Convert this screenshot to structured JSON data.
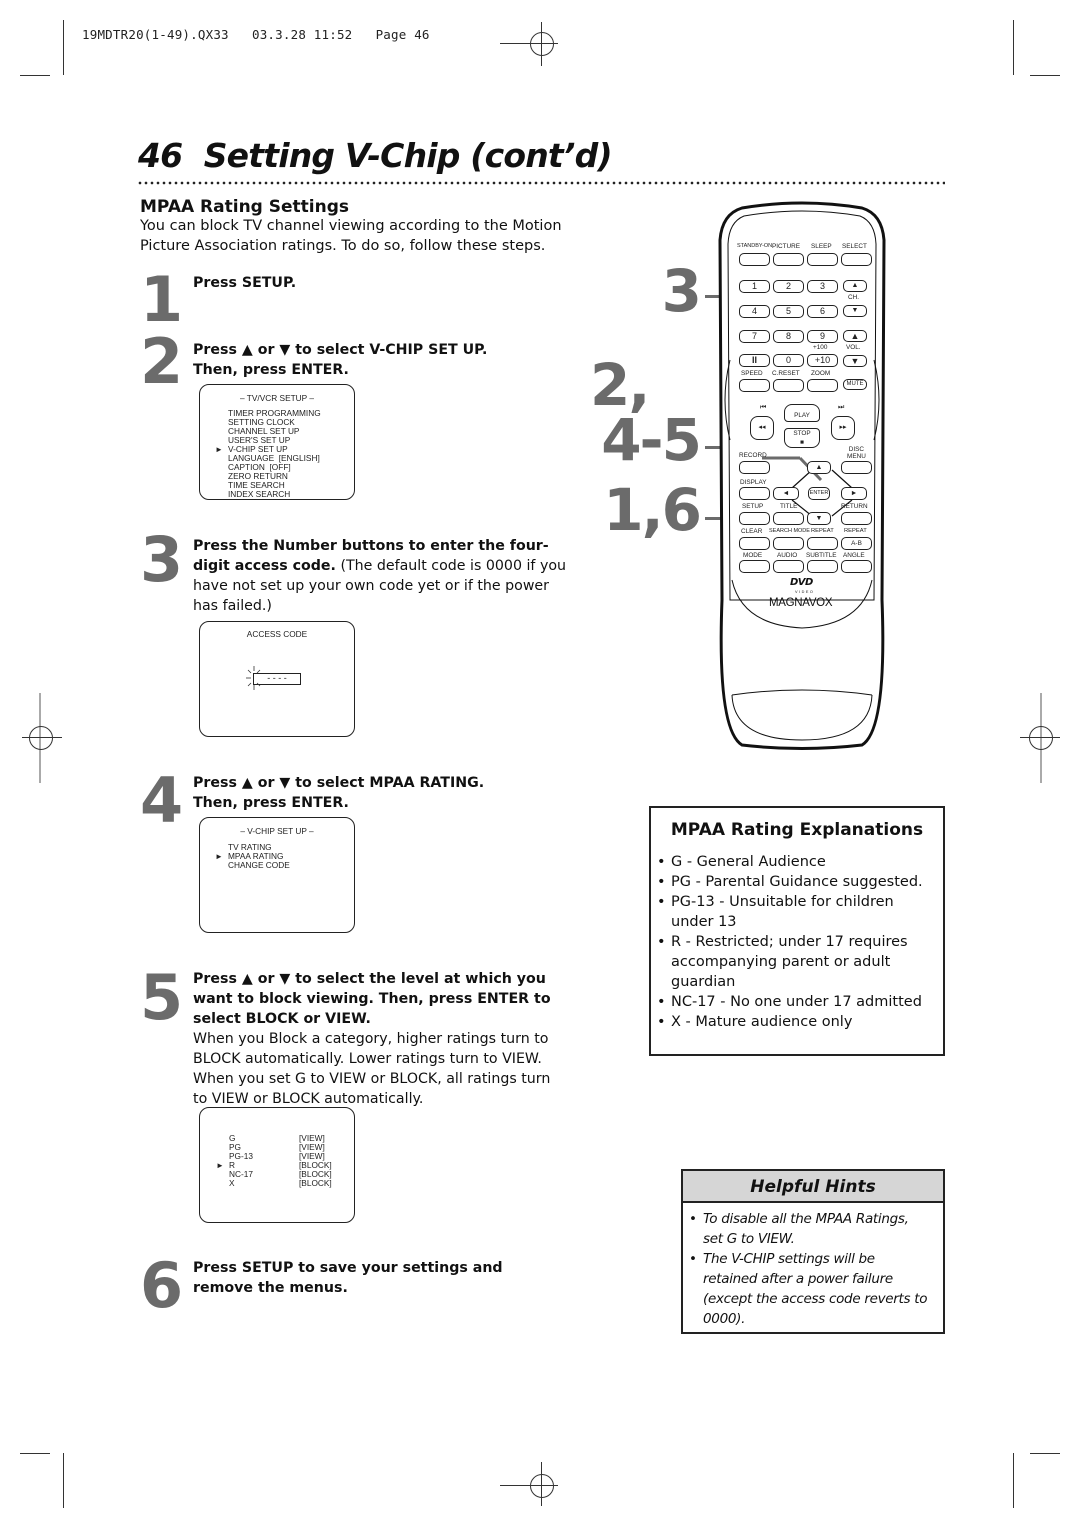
{
  "slug": {
    "text": "19MDTR20(1-49).QX33   03.3.28 11:52   Page 46"
  },
  "page": {
    "number": "46",
    "title": "Setting V-Chip (cont’d)"
  },
  "section": {
    "heading": "MPAA Rating Settings",
    "intro": [
      "You can block TV channel viewing according to the Motion",
      "Picture Association ratings. To do so, follow these steps."
    ]
  },
  "steps": [
    {
      "num": "1",
      "lines": [
        {
          "bold": "Press SETUP.",
          "normal": ""
        }
      ]
    },
    {
      "num": "2",
      "lines": [
        {
          "bold": "Press ▲ or ▼ to select V-CHIP SET UP.",
          "normal": ""
        },
        {
          "bold": "Then, press ENTER.",
          "normal": ""
        }
      ]
    },
    {
      "num": "3",
      "lines": [
        {
          "bold": "Press the Number buttons to enter the four-",
          "normal": ""
        },
        {
          "bold": "digit access code.",
          "normal": " (The default code is 0000 if you"
        },
        {
          "bold": "",
          "normal": "have not set up your own code yet or if the power"
        },
        {
          "bold": "",
          "normal": "has failed.)"
        }
      ]
    },
    {
      "num": "4",
      "lines": [
        {
          "bold": "Press ▲ or ▼ to select MPAA RATING.",
          "normal": ""
        },
        {
          "bold": "Then, press ENTER.",
          "normal": ""
        }
      ]
    },
    {
      "num": "5",
      "lines": [
        {
          "bold": "Press ▲ or ▼ to select the level at which you",
          "normal": ""
        },
        {
          "bold": "want to block viewing. Then, press ENTER to",
          "normal": ""
        },
        {
          "bold": "select BLOCK or VIEW.",
          "normal": ""
        },
        {
          "bold": "",
          "normal": "When you Block a category, higher ratings turn to"
        },
        {
          "bold": "",
          "normal": "BLOCK automatically. Lower ratings turn to VIEW."
        },
        {
          "bold": "",
          "normal": "When you set G to VIEW or BLOCK, all ratings turn"
        },
        {
          "bold": "",
          "normal": "to VIEW or BLOCK automatically."
        }
      ]
    },
    {
      "num": "6",
      "lines": [
        {
          "bold": "Press SETUP to save your settings and",
          "normal": ""
        },
        {
          "bold": "remove the menus.",
          "normal": ""
        }
      ]
    }
  ],
  "screens": {
    "tvvcr_setup": {
      "header": "– TV/VCR SETUP –",
      "items": [
        "TIMER PROGRAMMING",
        "SETTING CLOCK",
        "CHANNEL SET UP",
        "USER'S SET UP",
        "V-CHIP SET UP",
        "LANGUAGE  [ENGLISH]",
        "CAPTION  [OFF]",
        "ZERO RETURN",
        "TIME SEARCH",
        "INDEX SEARCH"
      ],
      "selected_index": 4
    },
    "access_code": {
      "header": "ACCESS CODE",
      "field": "- - - -"
    },
    "vchip_setup": {
      "header": "– V-CHIP SET UP –",
      "items": [
        "TV RATING",
        "MPAA RATING",
        "CHANGE CODE"
      ],
      "selected_index": 1
    },
    "mpaa_levels": {
      "rows": [
        {
          "rating": "G",
          "status": "[VIEW]"
        },
        {
          "rating": "PG",
          "status": "[VIEW]"
        },
        {
          "rating": "PG-13",
          "status": "[VIEW]"
        },
        {
          "rating": "R",
          "status": "[BLOCK]"
        },
        {
          "rating": "NC-17",
          "status": "[BLOCK]"
        },
        {
          "rating": "X",
          "status": "[BLOCK]"
        }
      ],
      "selected_index": 3
    },
    "arrow_glyph": "►"
  },
  "remote": {
    "brand": "MAGNAVOX",
    "disc_logo": "DVD",
    "disc_logo_sub": "VIDEO",
    "top_labels": [
      "STANDBY-ON",
      "PICTURE",
      "SLEEP",
      "SELECT"
    ],
    "digits": [
      "1",
      "2",
      "3",
      "4",
      "5",
      "6",
      "7",
      "8",
      "9",
      "II",
      "0",
      "+10"
    ],
    "plus100": "+100",
    "ch_label": "CH.",
    "vol_label": "VOL.",
    "row_labels": [
      "SPEED",
      "C.RESET",
      "ZOOM"
    ],
    "mute": "MUTE",
    "play": "PLAY",
    "stop": "STOP",
    "record": "RECORD",
    "disc_menu": [
      "DISC",
      "MENU"
    ],
    "display": "DISPLAY",
    "enter": "ENTER",
    "setup": "SETUP",
    "title": "TITLE",
    "return": "RETURN",
    "clear": "CLEAR",
    "search_mode": "SEARCH MODE",
    "repeat": "REPEAT",
    "repeat2": "REPEAT",
    "ab": "A-B",
    "mode": "MODE",
    "audio": "AUDIO",
    "subtitle": "SUBTITLE",
    "angle": "ANGLE",
    "callouts": [
      "3",
      "2,",
      "4-5",
      "1,6"
    ]
  },
  "explanations": {
    "heading": "MPAA Rating Explanations",
    "items": [
      [
        "G - General Audience"
      ],
      [
        "PG - Parental Guidance suggested."
      ],
      [
        "PG-13 - Unsuitable for children",
        "under 13"
      ],
      [
        "R - Restricted; under 17 requires",
        "accompanying parent or adult",
        "guardian"
      ],
      [
        "NC-17 - No one under 17 admitted"
      ],
      [
        "X - Mature audience only"
      ]
    ]
  },
  "hints": {
    "heading": "Helpful Hints",
    "items": [
      [
        "To disable all the MPAA Ratings,",
        "set G to VIEW."
      ],
      [
        "The V-CHIP settings will be",
        "retained after a power failure",
        "(except the access code reverts to",
        "0000)."
      ]
    ],
    "bullet": "•"
  }
}
